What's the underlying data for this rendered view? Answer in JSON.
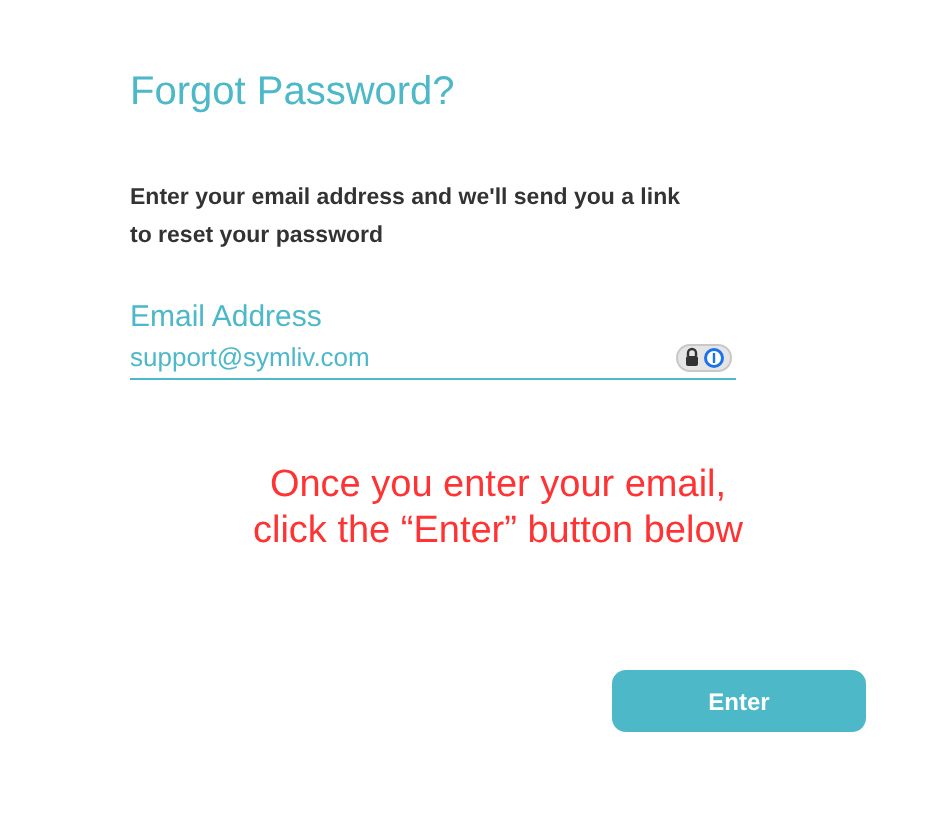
{
  "title": "Forgot Password?",
  "description": "Enter your email address and we'll send you a link to reset your password",
  "email_field": {
    "label": "Email Address",
    "value": "support@symliv.com"
  },
  "annotation": "Once you enter your email, click the “Enter” button below",
  "submit_button": {
    "label": "Enter"
  }
}
